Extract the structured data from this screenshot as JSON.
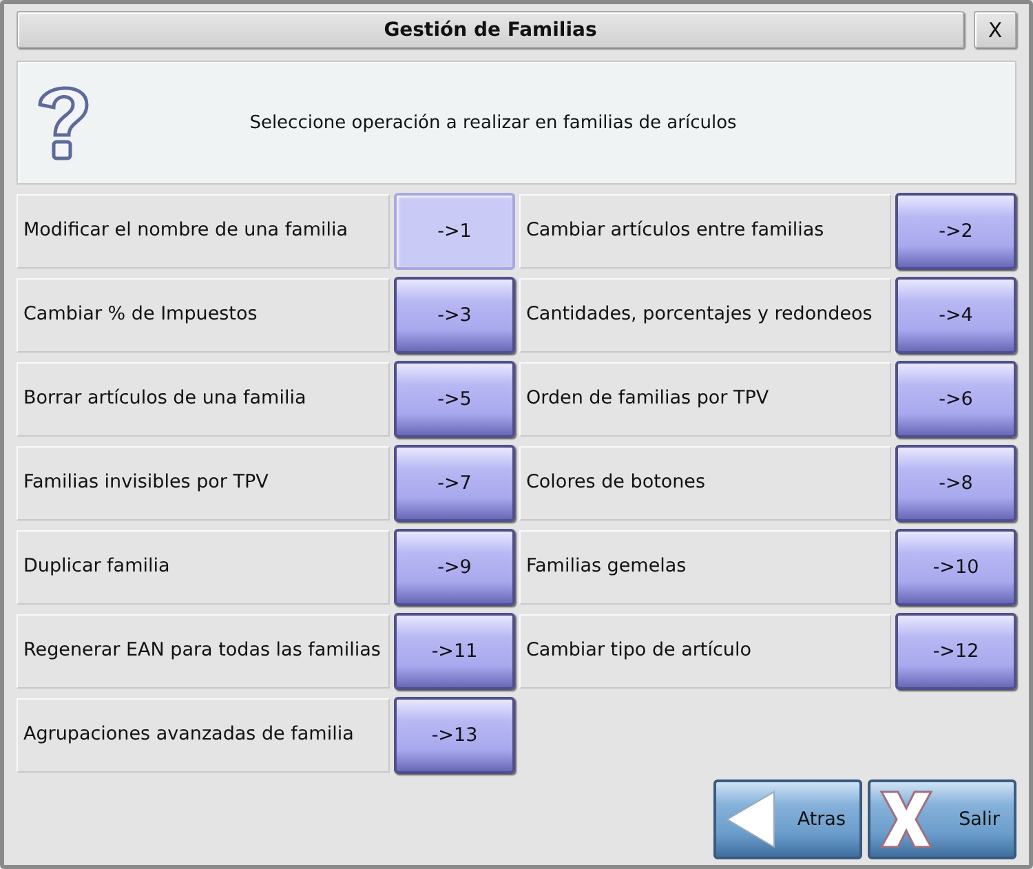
{
  "window": {
    "title": "Gestión de Familias",
    "close": "X"
  },
  "message": {
    "text": "Seleccione operación a realizar en familias de arículos"
  },
  "operations": [
    {
      "label": "Modificar el nombre de una familia",
      "button": "->1",
      "selected": true
    },
    {
      "label": "Cambiar artículos entre familias",
      "button": "->2",
      "selected": false
    },
    {
      "label": "Cambiar % de Impuestos",
      "button": "->3",
      "selected": false
    },
    {
      "label": "Cantidades, porcentajes y redondeos",
      "button": "->4",
      "selected": false
    },
    {
      "label": "Borrar artículos de una familia",
      "button": "->5",
      "selected": false
    },
    {
      "label": "Orden de familias por TPV",
      "button": "->6",
      "selected": false
    },
    {
      "label": "Familias invisibles por TPV",
      "button": "->7",
      "selected": false
    },
    {
      "label": "Colores de botones",
      "button": "->8",
      "selected": false
    },
    {
      "label": "Duplicar familia",
      "button": "->9",
      "selected": false
    },
    {
      "label": "Familias gemelas",
      "button": "->10",
      "selected": false
    },
    {
      "label": "Regenerar EAN para todas las familias",
      "button": "->11",
      "selected": false
    },
    {
      "label": "Cambiar tipo de artículo",
      "button": "->12",
      "selected": false
    },
    {
      "label": "Agrupaciones avanzadas de familia",
      "button": "->13",
      "selected": false
    }
  ],
  "footer": [
    {
      "kind": "back",
      "label": "Atras"
    },
    {
      "kind": "exit",
      "label": "Salir"
    }
  ]
}
